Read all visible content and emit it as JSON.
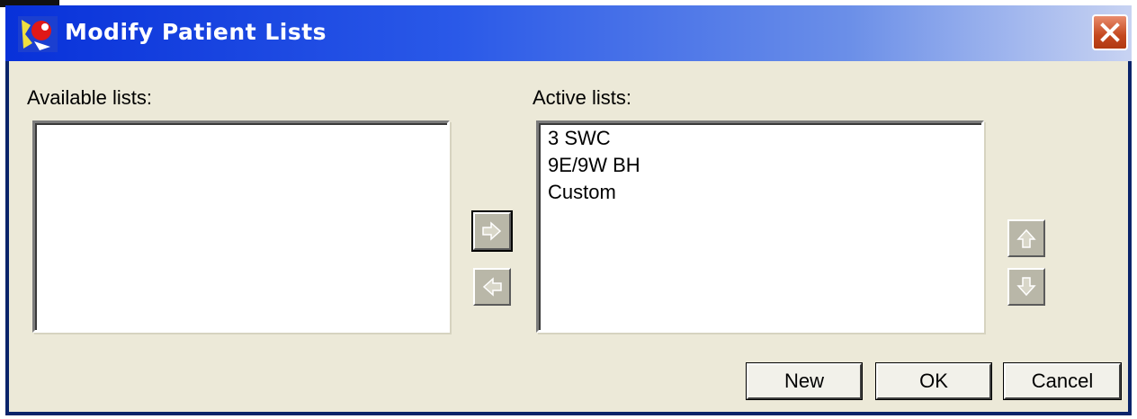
{
  "window": {
    "title": "Modify Patient Lists"
  },
  "available": {
    "label": "Available lists:",
    "items": []
  },
  "active": {
    "label": "Active lists:",
    "items": [
      "3 SWC",
      "9E/9W BH",
      "Custom"
    ]
  },
  "buttons": {
    "new_label": "New",
    "ok_label": "OK",
    "cancel_label": "Cancel"
  },
  "icons": {
    "add": "arrow-right-icon",
    "remove": "arrow-left-icon",
    "up": "arrow-up-icon",
    "down": "arrow-down-icon",
    "close": "close-icon"
  },
  "colors": {
    "titlebar": "#0831d9",
    "face": "#ece9d8",
    "close": "#c4481f"
  }
}
